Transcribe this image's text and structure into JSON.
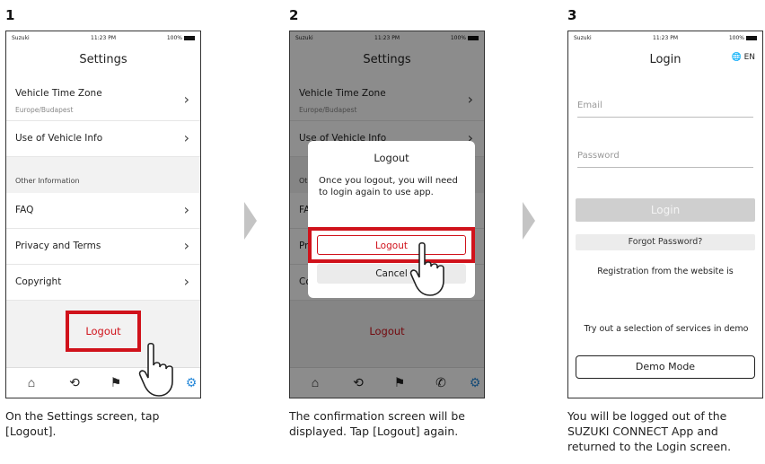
{
  "steps": [
    {
      "number": "1",
      "caption": "On the Settings screen, tap [Logout]."
    },
    {
      "number": "2",
      "caption": "The confirmation screen will be displayed. Tap [Logout] again."
    },
    {
      "number": "3",
      "caption": "You will be logged out of the SUZUKI CONNECT App and returned to the Login screen."
    }
  ],
  "status_bar": {
    "carrier": "Suzuki",
    "time": "11:23 PM",
    "battery": "100%"
  },
  "settings": {
    "title": "Settings",
    "rows": [
      {
        "label": "Vehicle Time Zone",
        "sub": "Europe/Budapest"
      },
      {
        "label": "Use of Vehicle Info"
      }
    ],
    "section_header": "Other Information",
    "info_rows": [
      {
        "label": "FAQ"
      },
      {
        "label": "Privacy and Terms"
      },
      {
        "label": "Copyright"
      }
    ],
    "logout_label": "Logout"
  },
  "tabbar": [
    "home-icon",
    "history-icon",
    "map-icon",
    "phone-icon",
    "settings-icon"
  ],
  "dialog": {
    "title": "Logout",
    "message": "Once you logout, you will need to login again to use app.",
    "logout_button": "Logout",
    "cancel_button": "Cancel"
  },
  "login": {
    "title": "Login",
    "language": "EN",
    "email_placeholder": "Email",
    "password_placeholder": "Password",
    "login_button": "Login",
    "forgot_password": "Forgot Password?",
    "registration_text": "Registration from the website is",
    "demo_text": "Try out a selection of services in demo",
    "demo_button": "Demo Mode"
  },
  "colors": {
    "accent_red": "#d0121b",
    "active_tab": "#2a8ad9",
    "arrow": "#c4c4c4"
  }
}
